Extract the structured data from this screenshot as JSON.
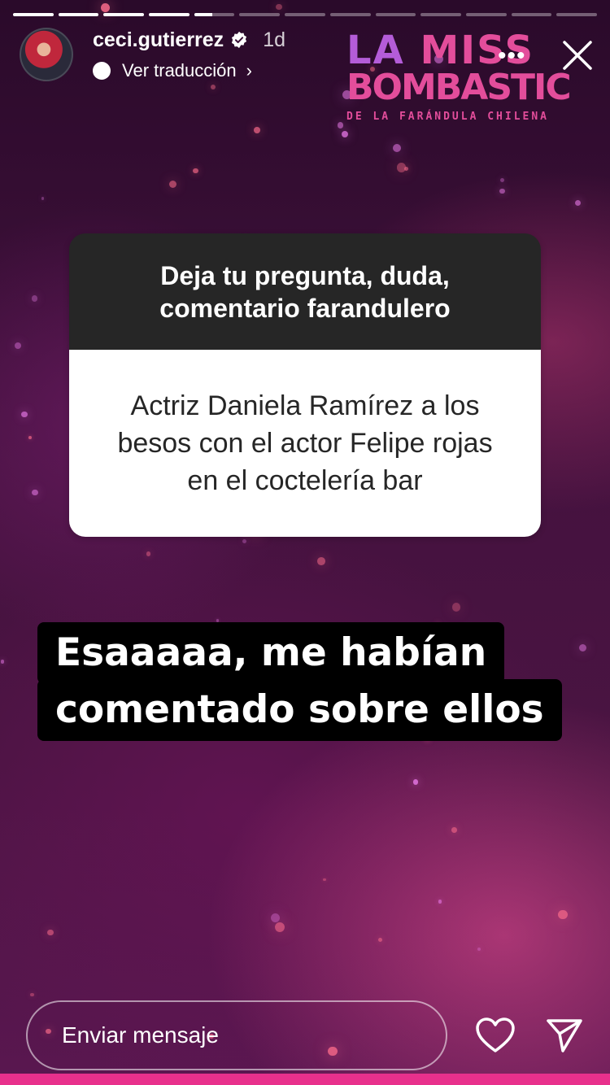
{
  "story": {
    "progress_segments": [
      1,
      1,
      1,
      1,
      0.45,
      0,
      0,
      0,
      0,
      0,
      0,
      0,
      0
    ]
  },
  "header": {
    "username": "ceci.gutierrez",
    "time_ago": "1d",
    "translate_label": "Ver traducción",
    "more_label": "•••"
  },
  "sticker_logo": {
    "line1_a": "LA",
    "line1_b": "MISS",
    "line2": "BOMBASTIC",
    "line3": "DE LA FARÁNDULA CHILENA"
  },
  "question_box": {
    "prompt": "Deja tu pregunta, duda, comentario farandulero",
    "answer": "Actriz Daniela Ramírez a los besos con el actor Felipe rojas en el coctelería bar"
  },
  "caption": {
    "line1": "Esaaaaa, me habían",
    "line2": "comentado sobre ellos"
  },
  "footer": {
    "message_placeholder": "Enviar mensaje"
  },
  "colors": {
    "accent_pink": "#e8308c",
    "logo_purple": "#b45cd8",
    "logo_pink": "#e34d9b",
    "question_header": "#262626"
  }
}
